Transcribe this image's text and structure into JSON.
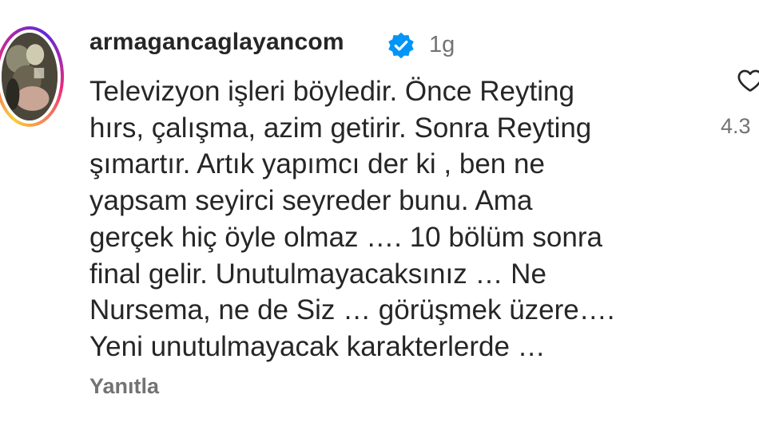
{
  "comment": {
    "username": "armagancaglayancom",
    "timestamp": "1g",
    "text_lines": [
      "Televizyon işleri böyledir. Önce Reyting",
      "hırs, çalışma, azim getirir. Sonra Reyting",
      "şımartır. Artık yapımcı der ki , ben ne",
      "yapsam seyirci seyreder bunu. Ama",
      "gerçek hiç öyle olmaz …. 10 bölüm sonra",
      "final gelir. Unutulmayacaksınız … Ne",
      "Nursema, ne de Siz … görüşmek üzere….",
      "Yeni unutulmayacak karakterlerde …"
    ],
    "reply_label": "Yanıtla",
    "like_count": "4.3",
    "icons": {
      "verified": "verified-badge-icon",
      "like": "heart-icon"
    }
  },
  "colors": {
    "text": "#262626",
    "secondary": "#737373",
    "verified_blue": "#0095f6"
  }
}
